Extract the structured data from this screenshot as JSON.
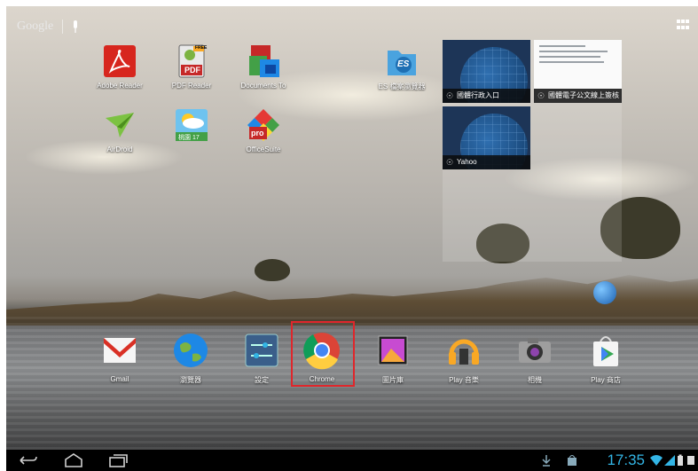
{
  "screen": {
    "search_label": "Google",
    "clock": "17:35"
  },
  "home_apps": [
    {
      "label": "Adobe Reader",
      "icon": "adobe-reader-icon"
    },
    {
      "label": "PDF Reader",
      "icon": "pdf-reader-icon",
      "badge": "FREE",
      "sub": "PDF"
    },
    {
      "label": "Documents To",
      "icon": "documents-to-go-icon"
    },
    {
      "label": "ES 檔案瀏覽器",
      "icon": "es-file-explorer-icon",
      "sub": "ES"
    },
    {
      "label": "AirDroid",
      "icon": "airdroid-icon"
    },
    {
      "label": "",
      "icon": "weather-app-icon",
      "sub": "桃園 17"
    },
    {
      "label": "OfficeSuite",
      "icon": "officesuite-icon",
      "sub": "pro"
    }
  ],
  "bookmarks": [
    {
      "label": "國體行政入口"
    },
    {
      "label": "國體電子公文線上簽核"
    },
    {
      "label": "Yahoo"
    }
  ],
  "dock": [
    {
      "label": "Gmail",
      "icon": "gmail-icon"
    },
    {
      "label": "瀏覽器",
      "icon": "browser-globe-icon"
    },
    {
      "label": "設定",
      "icon": "settings-icon"
    },
    {
      "label": "Chrome",
      "icon": "chrome-icon"
    },
    {
      "label": "圖片庫",
      "icon": "gallery-icon"
    },
    {
      "label": "Play 音樂",
      "icon": "play-music-icon"
    },
    {
      "label": "相機",
      "icon": "camera-icon"
    },
    {
      "label": "Play 商店",
      "icon": "play-store-icon"
    }
  ],
  "colors": {
    "highlight": "#e0262b",
    "clock": "#33b5e5"
  }
}
